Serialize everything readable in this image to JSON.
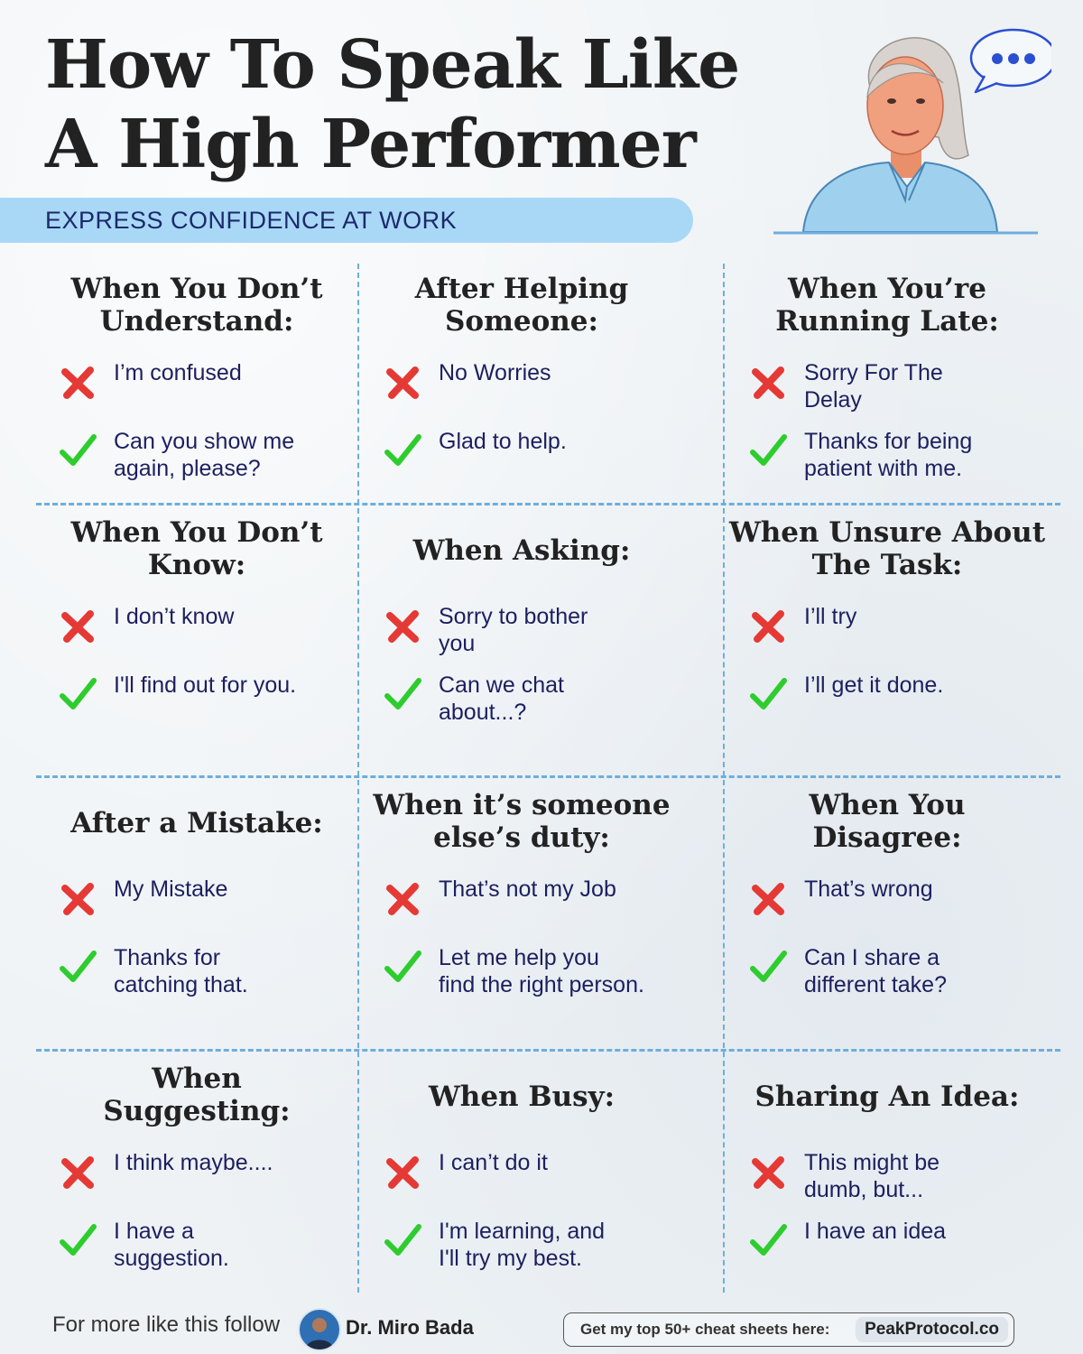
{
  "header": {
    "title_line1": "How To Speak Like",
    "title_line2": "A High Performer",
    "subtitle": "EXPRESS CONFIDENCE AT WORK"
  },
  "colors": {
    "accent": "#a9d8f7",
    "wrong": "#e53935",
    "right": "#2ecc2e",
    "divider": "#6eaedc"
  },
  "icons": {
    "wrong": "cross-icon",
    "right": "check-icon",
    "speech": "speech-bubble-icon"
  },
  "sections": [
    {
      "title": "When You Don’t\nUnderstand:",
      "wrong": "I’m confused",
      "right": "Can you show me\nagain, please?"
    },
    {
      "title": "After Helping\nSomeone:",
      "wrong": "No Worries",
      "right": "Glad to help."
    },
    {
      "title": "When You’re\nRunning Late:",
      "wrong": "Sorry For The\nDelay",
      "right": "Thanks for being\npatient with me."
    },
    {
      "title": "When You Don’t\nKnow:",
      "wrong": "I don’t know",
      "right": "I'll find out for you."
    },
    {
      "title": "When Asking:",
      "wrong": "Sorry to bother\nyou",
      "right": "Can we chat\nabout...?"
    },
    {
      "title": "When Unsure About\nThe Task:",
      "wrong": "I’ll try",
      "right": "I’ll get it done."
    },
    {
      "title": "After a Mistake:",
      "wrong": "My Mistake",
      "right": "Thanks for\ncatching that."
    },
    {
      "title": "When it’s someone\nelse’s duty:",
      "wrong": "That’s not my Job",
      "right": "Let me help you\nfind the right person."
    },
    {
      "title": "When You\nDisagree:",
      "wrong": "That’s wrong",
      "right": "Can I share a\ndifferent take?"
    },
    {
      "title": "When\nSuggesting:",
      "wrong": "I think maybe....",
      "right": "I have a\nsuggestion."
    },
    {
      "title": "When Busy:",
      "wrong": "I can’t do it",
      "right": "I'm learning, and\nI'll try my best."
    },
    {
      "title": "Sharing An Idea:",
      "wrong": "This might be\ndumb, but...",
      "right": "I have an idea"
    }
  ],
  "footer": {
    "follow_text": "For more like this follow",
    "author": "Dr. Miro Bada",
    "cta_text": "Get my top 50+ cheat sheets here:",
    "cta_link": "PeakProtocol.co"
  }
}
